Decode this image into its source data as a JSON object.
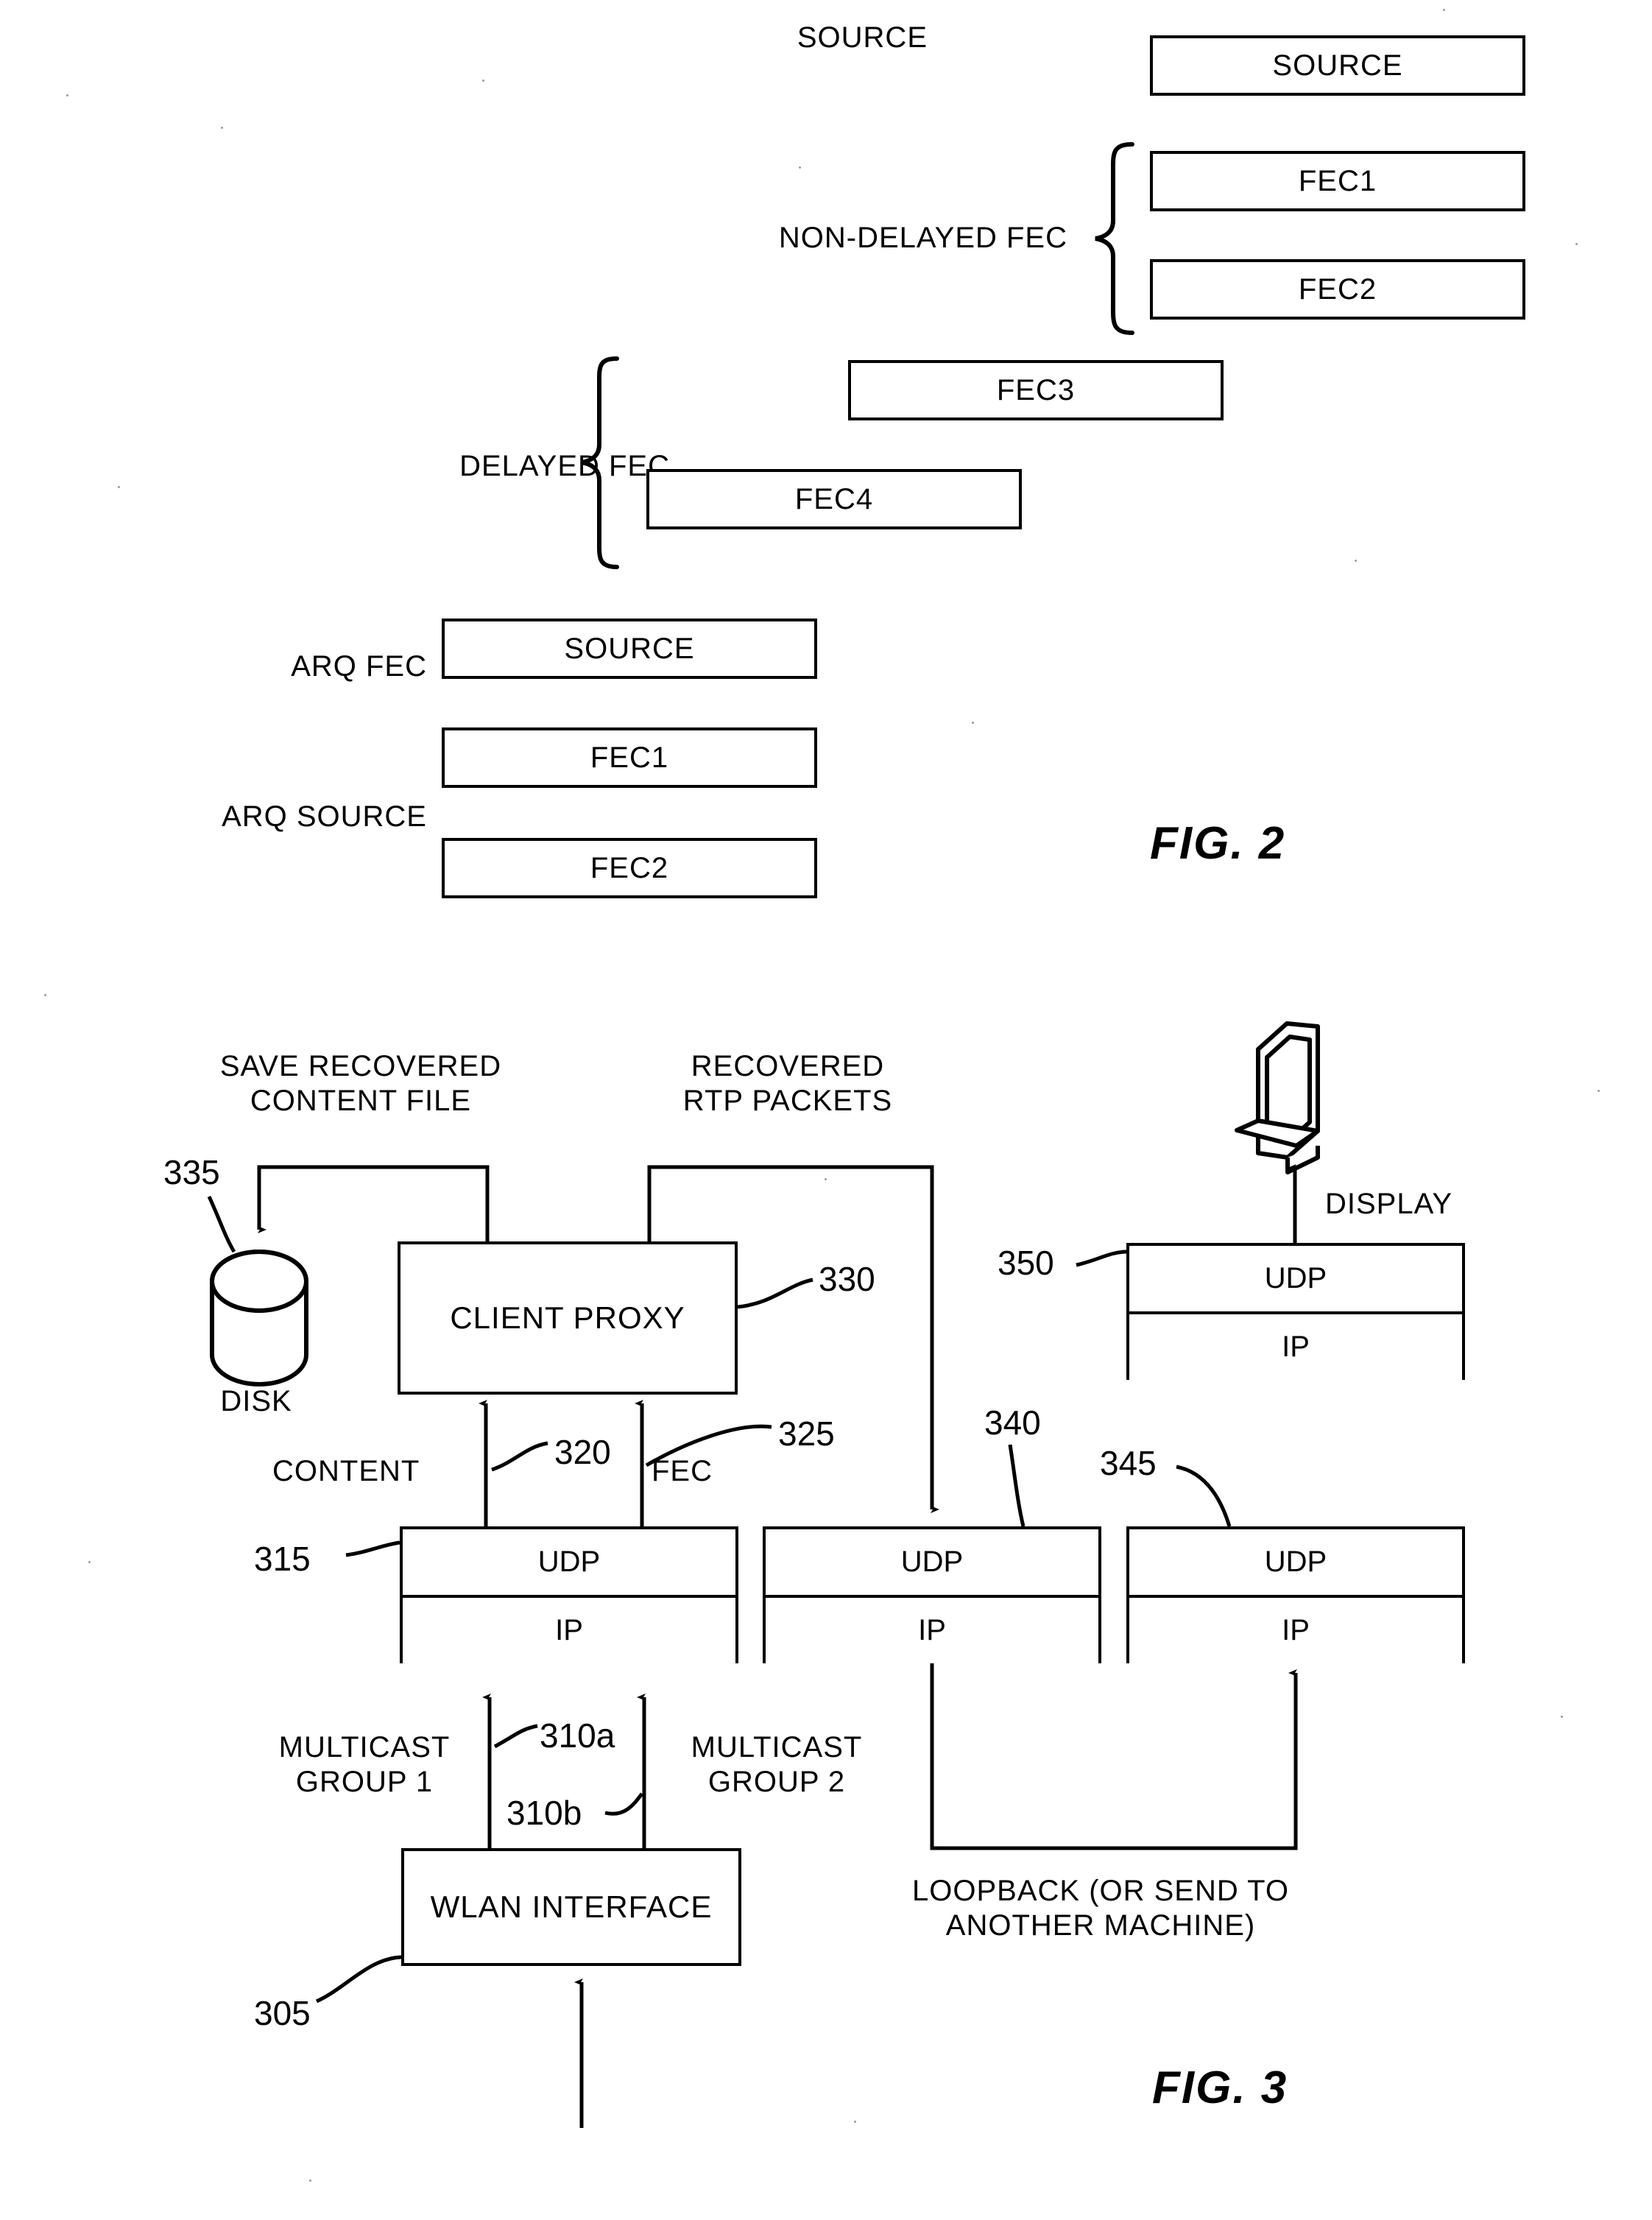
{
  "figures": [
    {
      "id": "fig2",
      "caption": "FIG. 2",
      "group_labels": {
        "source": "SOURCE",
        "non_delayed_fec": "NON-DELAYED FEC",
        "delayed_fec": "DELAYED FEC",
        "arq_fec": "ARQ FEC",
        "arq_source": "ARQ SOURCE"
      },
      "packets": [
        {
          "label": "SOURCE",
          "group": "source"
        },
        {
          "label": "FEC1",
          "group": "non_delayed_fec"
        },
        {
          "label": "FEC2",
          "group": "non_delayed_fec"
        },
        {
          "label": "FEC3",
          "group": "delayed_fec"
        },
        {
          "label": "FEC4",
          "group": "delayed_fec"
        },
        {
          "label": "SOURCE",
          "group": "arq_fec"
        },
        {
          "label": "FEC1",
          "group": "arq_source"
        },
        {
          "label": "FEC2",
          "group": "arq_source"
        }
      ]
    },
    {
      "id": "fig3",
      "caption": "FIG. 3",
      "blocks": {
        "client_proxy": "CLIENT PROXY",
        "wlan_interface": "WLAN INTERFACE",
        "udp": "UDP",
        "ip": "IP",
        "disk": "DISK",
        "display": "DISPLAY"
      },
      "annotations": {
        "save_recovered_content_file": "SAVE RECOVERED\nCONTENT FILE",
        "recovered_rtp_packets": "RECOVERED\nRTP PACKETS",
        "content": "CONTENT",
        "fec": "FEC",
        "multicast_group_1": "MULTICAST\nGROUP 1",
        "multicast_group_2": "MULTICAST\nGROUP 2",
        "loopback": "LOOPBACK (OR SEND TO\nANOTHER MACHINE)"
      },
      "reference_numerals": {
        "wlan_interface": "305",
        "multicast_stream_a": "310a",
        "multicast_stream_b": "310b",
        "stack_left": "315",
        "content_stream": "320",
        "fec_stream": "325",
        "client_proxy": "330",
        "disk": "335",
        "stack_middle": "340",
        "stack_right": "345",
        "stack_display": "350"
      }
    }
  ],
  "colors": {
    "ink": "#000000",
    "paper": "#ffffff"
  }
}
